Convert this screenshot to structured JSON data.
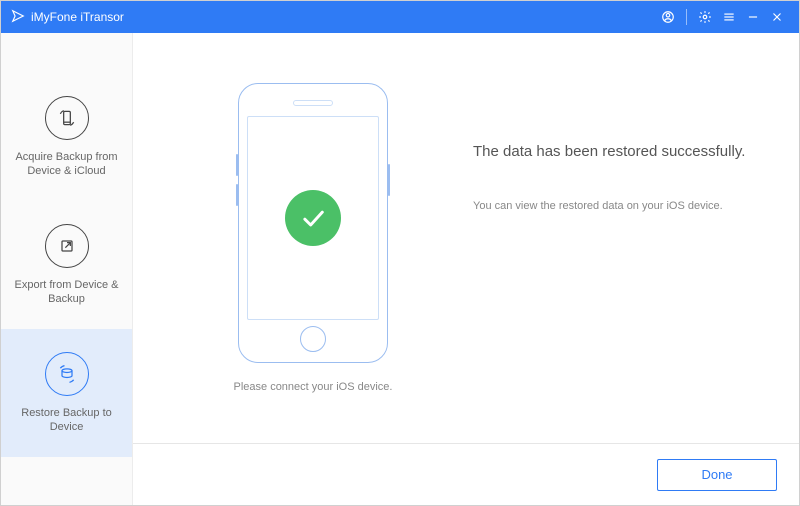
{
  "titlebar": {
    "app_name": "iMyFone iTransor"
  },
  "sidebar": {
    "items": [
      {
        "label": "Acquire Backup from Device & iCloud"
      },
      {
        "label": "Export from Device & Backup"
      },
      {
        "label": "Restore Backup to Device"
      }
    ]
  },
  "main": {
    "connect_prompt": "Please connect your iOS device.",
    "success_title": "The data has been restored successfully.",
    "success_sub": "You can view the restored data on your iOS device."
  },
  "footer": {
    "done_label": "Done"
  }
}
